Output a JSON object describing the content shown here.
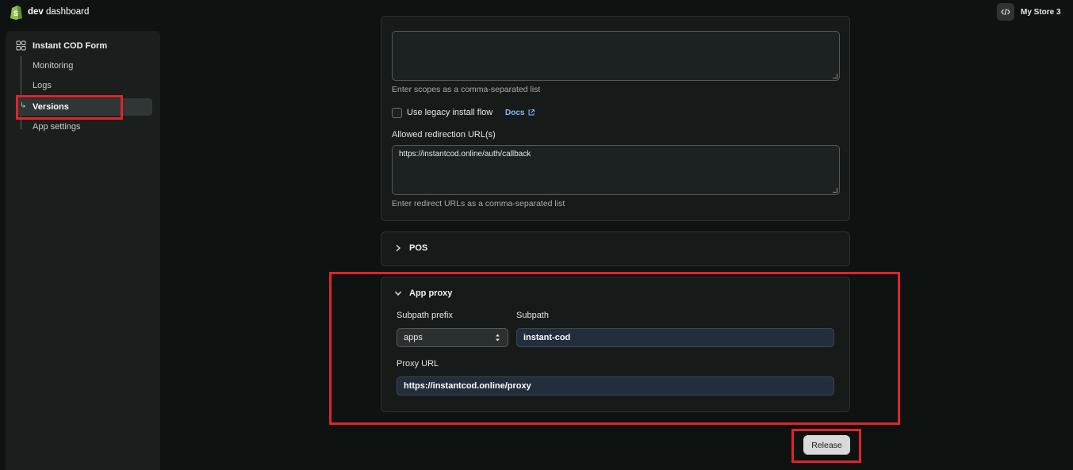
{
  "topbar": {
    "brand_bold": "dev",
    "brand_rest": "dashboard",
    "store_name": "My Store 3"
  },
  "sidebar": {
    "app_name": "Instant COD Form",
    "items": [
      {
        "label": "Monitoring"
      },
      {
        "label": "Logs"
      },
      {
        "label": "Versions",
        "active": true
      },
      {
        "label": "App settings"
      }
    ]
  },
  "access": {
    "scopes_value": "",
    "scopes_help": "Enter scopes as a comma-separated list",
    "legacy_label": "Use legacy install flow",
    "docs_label": "Docs",
    "redirect_label": "Allowed redirection URL(s)",
    "redirect_value": "https://instantcod.online/auth/callback",
    "redirect_help": "Enter redirect URLs as a comma-separated list"
  },
  "pos": {
    "title": "POS"
  },
  "app_proxy": {
    "title": "App proxy",
    "subpath_prefix_label": "Subpath prefix",
    "subpath_prefix_value": "apps",
    "subpath_label": "Subpath",
    "subpath_value": "instant-cod",
    "proxy_url_label": "Proxy URL",
    "proxy_url_value": "https://instantcod.online/proxy"
  },
  "actions": {
    "release_label": "Release"
  },
  "colors": {
    "highlight": "#e0242b",
    "link": "#8db7ff",
    "background": "#0e1312"
  }
}
